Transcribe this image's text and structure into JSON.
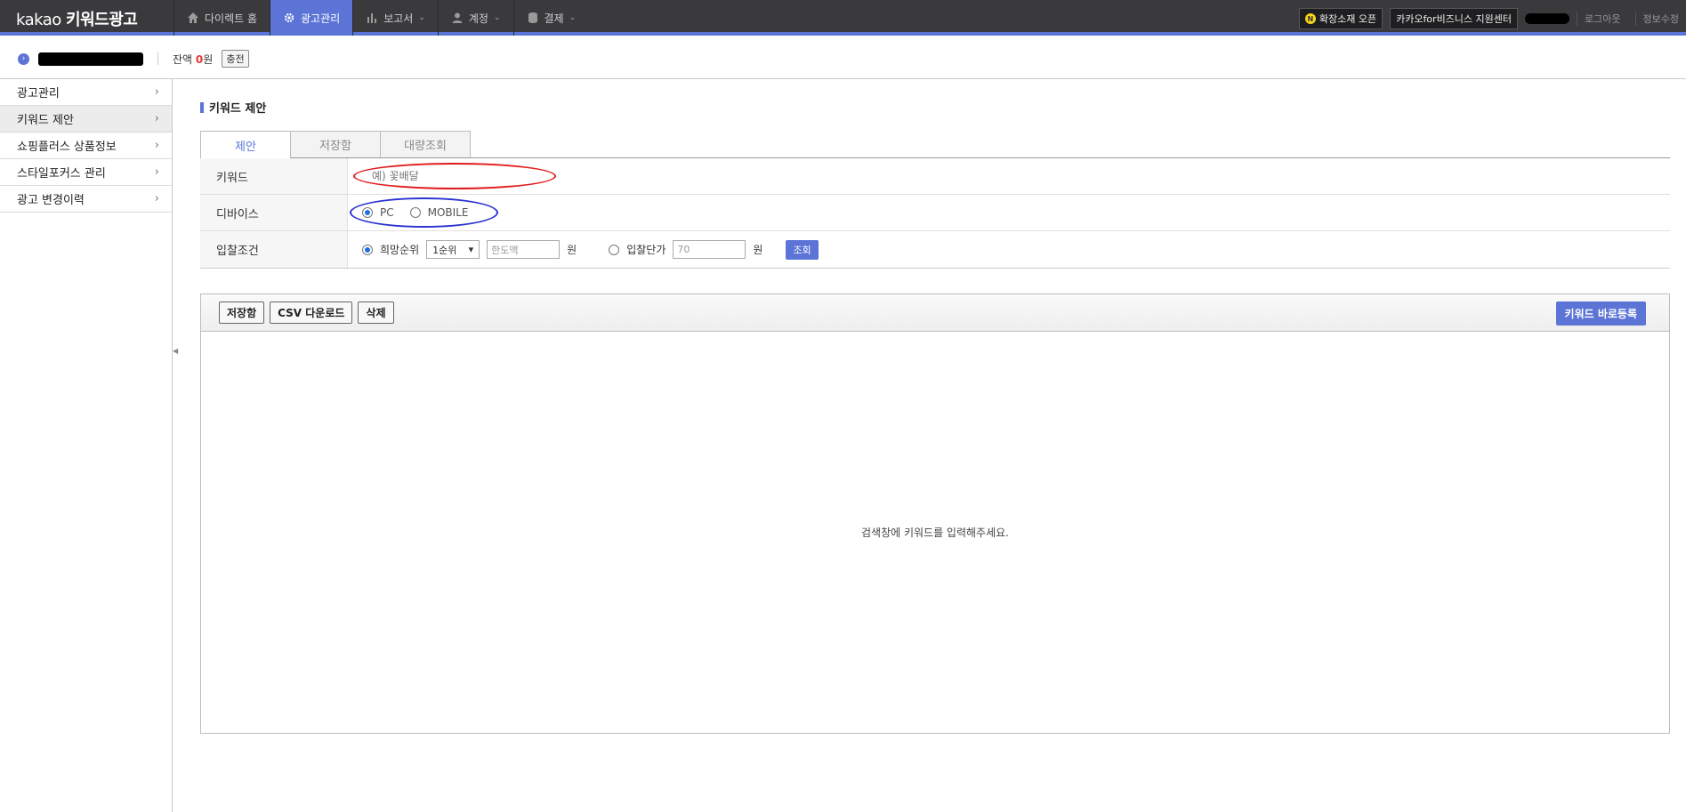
{
  "topbar": {
    "logo_light": "kakao",
    "logo_bold": "키워드광고",
    "nav": [
      {
        "label": "다이렉트 홈",
        "icon": "home-icon"
      },
      {
        "label": "광고관리",
        "icon": "gear-icon",
        "active": true
      },
      {
        "label": "보고서",
        "icon": "bar-chart-icon"
      },
      {
        "label": "계정",
        "icon": "user-icon"
      },
      {
        "label": "결제",
        "icon": "database-icon"
      }
    ],
    "badge_letter": "N",
    "promo": "확장소재 오픈",
    "support": "카카오for비즈니스 지원센터",
    "logout": "로그아웃",
    "profile": "정보수정"
  },
  "subhead": {
    "balance_label": "잔액",
    "balance_value": "0",
    "balance_unit": "원",
    "charge": "충전"
  },
  "sidebar": {
    "items": [
      {
        "label": "광고관리"
      },
      {
        "label": "키워드 제안",
        "active": true
      },
      {
        "label": "쇼핑플러스 상품정보"
      },
      {
        "label": "스타일포커스 관리"
      },
      {
        "label": "광고 변경이력"
      }
    ]
  },
  "main": {
    "title": "키워드 제안",
    "tabs": [
      "제안",
      "저장함",
      "대량조회"
    ],
    "form": {
      "keyword_label": "키워드",
      "keyword_placeholder": "예) 꽃배달",
      "device_label": "디바이스",
      "device_pc": "PC",
      "device_mobile": "MOBILE",
      "bid_label": "입찰조건",
      "bid_rank_label": "희망순위",
      "bid_rank_value": "1순위",
      "bid_limit_placeholder": "한도액",
      "unit": "원",
      "bid_price_label": "입찰단가",
      "bid_price_value": "70",
      "query": "조회"
    },
    "toolbar": {
      "save": "저장함",
      "csv": "CSV 다운로드",
      "delete": "삭제",
      "register": "키워드 바로등록"
    },
    "empty_message": "검색창에 키워드를 입력해주세요."
  },
  "colors": {
    "accent": "#5b74d6",
    "topbar": "#3a3a3d",
    "annotation_red": "#e01b1b",
    "annotation_blue": "#2a33cf"
  }
}
